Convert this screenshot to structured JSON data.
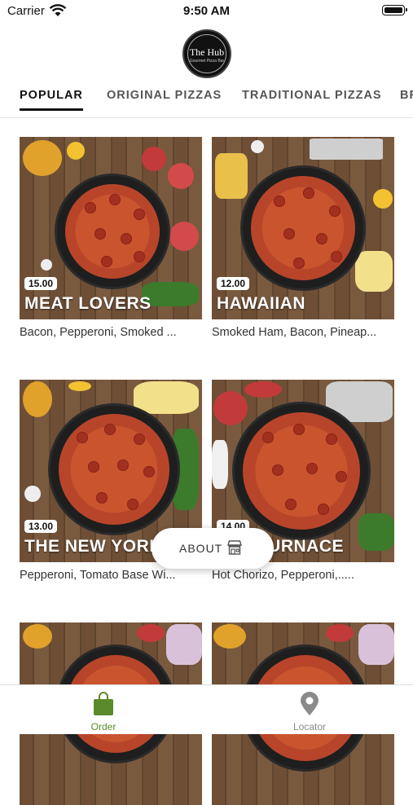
{
  "status_bar": {
    "carrier": "Carrier",
    "time": "9:50 AM"
  },
  "brand": {
    "name": "The Hub",
    "tagline": "Gourmet Pizza Bar"
  },
  "tabs": [
    {
      "label": "POPULAR",
      "active": true
    },
    {
      "label": "ORIGINAL PIZZAS",
      "active": false
    },
    {
      "label": "TRADITIONAL PIZZAS",
      "active": false
    },
    {
      "label": "BR",
      "active": false
    }
  ],
  "products": [
    {
      "title": "MEAT LOVERS",
      "price": "15.00",
      "description": "Bacon, Pepperoni, Smoked ..."
    },
    {
      "title": "HAWAIIAN",
      "price": "12.00",
      "description": "Smoked Ham, Bacon, Pineap..."
    },
    {
      "title": "THE NEW YORK",
      "price": "13.00",
      "description": "Pepperoni, Tomato Base Wi..."
    },
    {
      "title": "THE FURNACE",
      "price": "14.00",
      "description": "Hot Chorizo, Pepperoni,....."
    },
    {
      "title": "",
      "price": "",
      "description": ""
    },
    {
      "title": "",
      "price": "",
      "description": ""
    }
  ],
  "about_button": {
    "label": "ABOUT",
    "icon": "store-icon"
  },
  "bottom_nav": [
    {
      "label": "Order",
      "icon": "shopping-bag-icon",
      "active": true
    },
    {
      "label": "Locator",
      "icon": "map-pin-icon",
      "active": false
    }
  ],
  "colors": {
    "accent": "#5a8a2a",
    "inactive": "#8a8a8a",
    "text": "#222222"
  }
}
